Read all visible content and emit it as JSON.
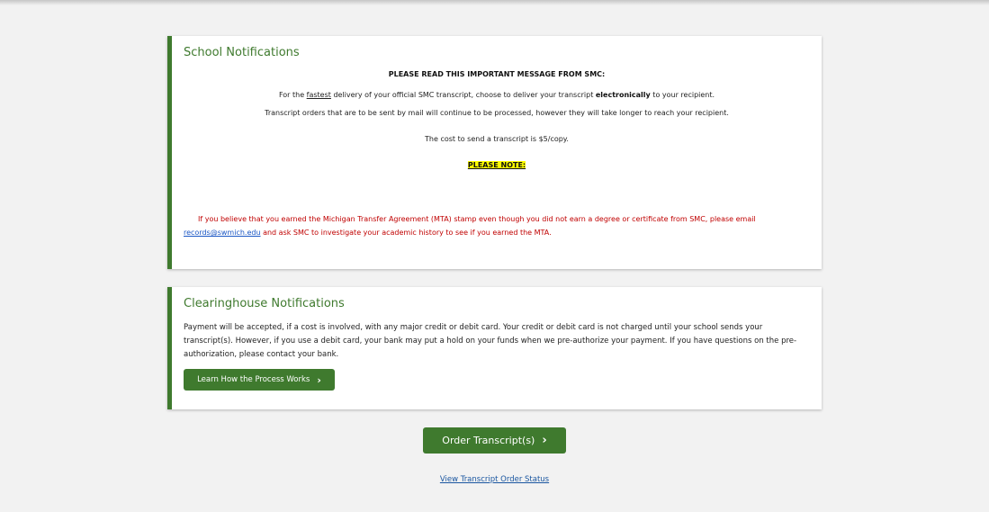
{
  "school_notifications": {
    "title": "School Notifications",
    "heading": "PLEASE READ THIS IMPORTANT MESSAGE FROM SMC:",
    "line2_pre": "For the ",
    "line2_fastest": "fastest",
    "line2_mid": " delivery of your official SMC transcript, choose to deliver your transcript ",
    "line2_bold": "electronically",
    "line2_post": " to your recipient.",
    "line3": "Transcript orders that are to be sent by mail will continue to be processed, however they will take longer to reach your recipient.",
    "line4": "The cost to send a transcript is $5/copy.",
    "please_note": "PLEASE NOTE:",
    "mta_pre": "If you believe that you earned the Michigan Transfer Agreement (MTA) stamp even though you did not earn a degree or certificate from SMC, please email ",
    "mta_email": "records@swmich.edu",
    "mta_post": " and ask SMC to investigate your academic history to see if you earned the MTA."
  },
  "clearinghouse_notifications": {
    "title": "Clearinghouse Notifications",
    "body": "Payment will be accepted, if a cost is involved, with any major credit or debit card. Your credit or debit card is not charged until your school sends your transcript(s). However, if you use a debit card, your bank may put a hold on your funds when we pre-authorize your payment. If you have questions on the pre-authorization, please contact your bank.",
    "learn_button": "Learn How the Process Works"
  },
  "actions": {
    "order_button": "Order Transcript(s)",
    "status_link": "View Transcript Order Status"
  },
  "colors": {
    "accent": "#3f7a2e",
    "warning_text": "#c00000",
    "highlight": "#ffff00",
    "link": "#1a56c4"
  },
  "icons": {
    "chevron": "chevron-right-icon"
  }
}
